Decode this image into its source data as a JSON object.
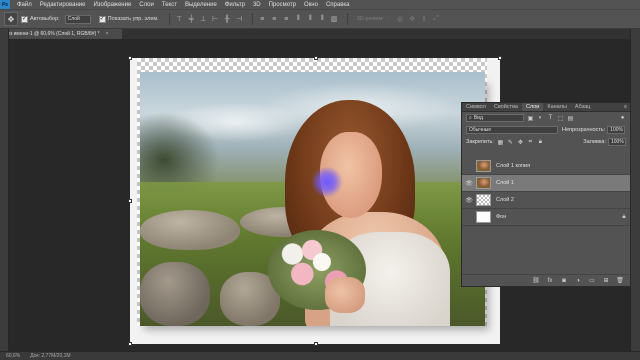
{
  "app": {
    "logo": "Ps"
  },
  "menu": [
    "Файл",
    "Редактирование",
    "Изображение",
    "Слои",
    "Текст",
    "Выделение",
    "Фильтр",
    "3D",
    "Просмотр",
    "Окно",
    "Справка"
  ],
  "options": {
    "tool_icon": "move-tool-icon",
    "autoselect_label": "Автовыбор:",
    "autoselect_value": "Слой",
    "show_controls_label": "Показать упр. элем.",
    "mode_3d_label": "3D-режим:"
  },
  "document": {
    "tab_title": "Без имени-1 @ 60,6% (Слой 1, RGB/8#) *",
    "close_glyph": "×"
  },
  "status": {
    "zoom": "60,6%",
    "doc_size": "Док: 2,77M/20,1M"
  },
  "layers_panel": {
    "tabs": [
      "Символ",
      "Свойства",
      "Слои",
      "Каналы",
      "Абзац"
    ],
    "active_tab": "Слои",
    "menu_glyph": "≡",
    "filter_kind": "Вид",
    "blend_mode": "Обычные",
    "opacity_label": "Непрозрачность:",
    "opacity_value": "100%",
    "lock_label": "Закрепить:",
    "fill_label": "Заливка:",
    "fill_value": "100%",
    "layers": [
      {
        "name": "Слой 1 копия",
        "visible": false,
        "selected": false,
        "thumb": "photo",
        "locked": false
      },
      {
        "name": "Слой 1",
        "visible": true,
        "selected": true,
        "thumb": "photo",
        "locked": false
      },
      {
        "name": "Слой 2",
        "visible": true,
        "selected": false,
        "thumb": "transparent",
        "locked": false
      },
      {
        "name": "Фон",
        "visible": false,
        "selected": false,
        "thumb": "white",
        "locked": true
      }
    ]
  },
  "colors": {
    "ui_bg": "#535353",
    "workspace_bg": "#282828",
    "selection_glow": "#6e5aff",
    "selected_layer": "#7a7a7a"
  }
}
